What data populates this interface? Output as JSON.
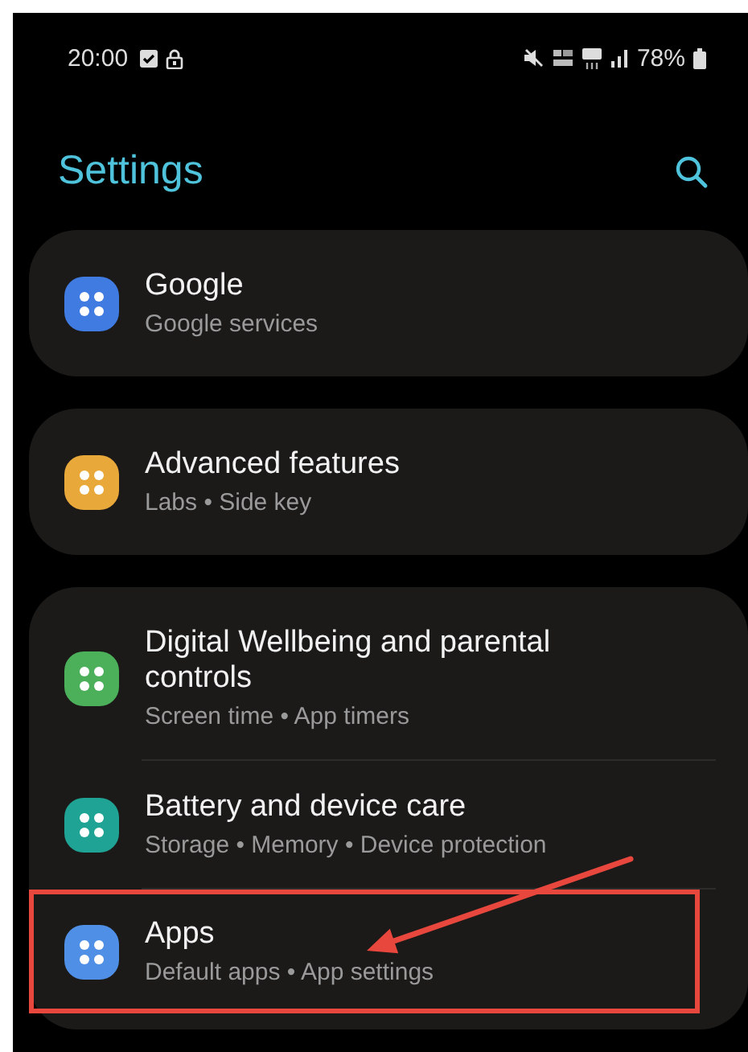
{
  "status_bar": {
    "time": "20:00",
    "battery": "78%"
  },
  "header": {
    "title": "Settings"
  },
  "groups": [
    {
      "items": [
        {
          "title": "Google",
          "subtitle": "Google services",
          "color": "#3f7be0",
          "highlighted": false
        }
      ]
    },
    {
      "items": [
        {
          "title": "Advanced features",
          "subtitle": "Labs • Side key",
          "color": "#e9a93a",
          "highlighted": false
        }
      ]
    },
    {
      "items": [
        {
          "title": "Digital Wellbeing and parental controls",
          "subtitle": "Screen time • App timers",
          "color": "#4caf5a",
          "highlighted": false
        },
        {
          "title": "Battery and device care",
          "subtitle": "Storage • Memory • Device protection",
          "color": "#1fa394",
          "highlighted": false
        },
        {
          "title": "Apps",
          "subtitle": "Default apps  •  App settings",
          "color": "#4f8fe6",
          "highlighted": true
        }
      ]
    }
  ]
}
